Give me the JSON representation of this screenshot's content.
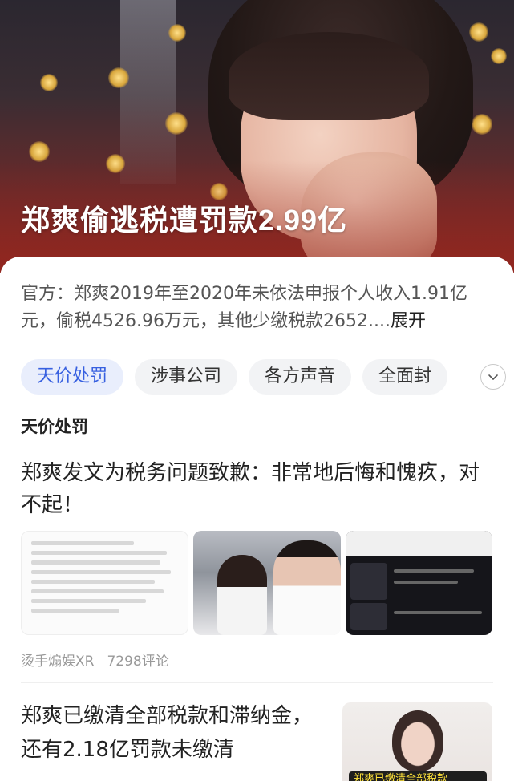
{
  "hero": {
    "title": "郑爽偷逃税遭罚款2.99亿"
  },
  "summary": {
    "text": "官方：郑爽2019年至2020年未依法申报个人收入1.91亿元，偷税4526.96万元，其他少缴税款2652....",
    "expand_label": "展开"
  },
  "tabs": [
    {
      "label": "天价处罚",
      "active": true
    },
    {
      "label": "涉事公司",
      "active": false
    },
    {
      "label": "各方声音",
      "active": false
    },
    {
      "label": "全面封",
      "active": false
    }
  ],
  "tabs_toggle_icon": "chevron-down-icon",
  "section": {
    "label": "天价处罚"
  },
  "news": [
    {
      "title": "郑爽发文为税务问题致歉：非常地后悔和愧疚，对不起！",
      "source": "烫手煽娱XR",
      "comments": "7298评论"
    },
    {
      "title": "郑爽已缴清全部税款和滞纳金，还有2.18亿罚款未缴清",
      "thumb_caption": "郑爽已缴清全部税款"
    }
  ],
  "colors": {
    "accent": "#3760e0",
    "active_tab_bg": "#e9eefc",
    "muted_text": "#999999"
  }
}
